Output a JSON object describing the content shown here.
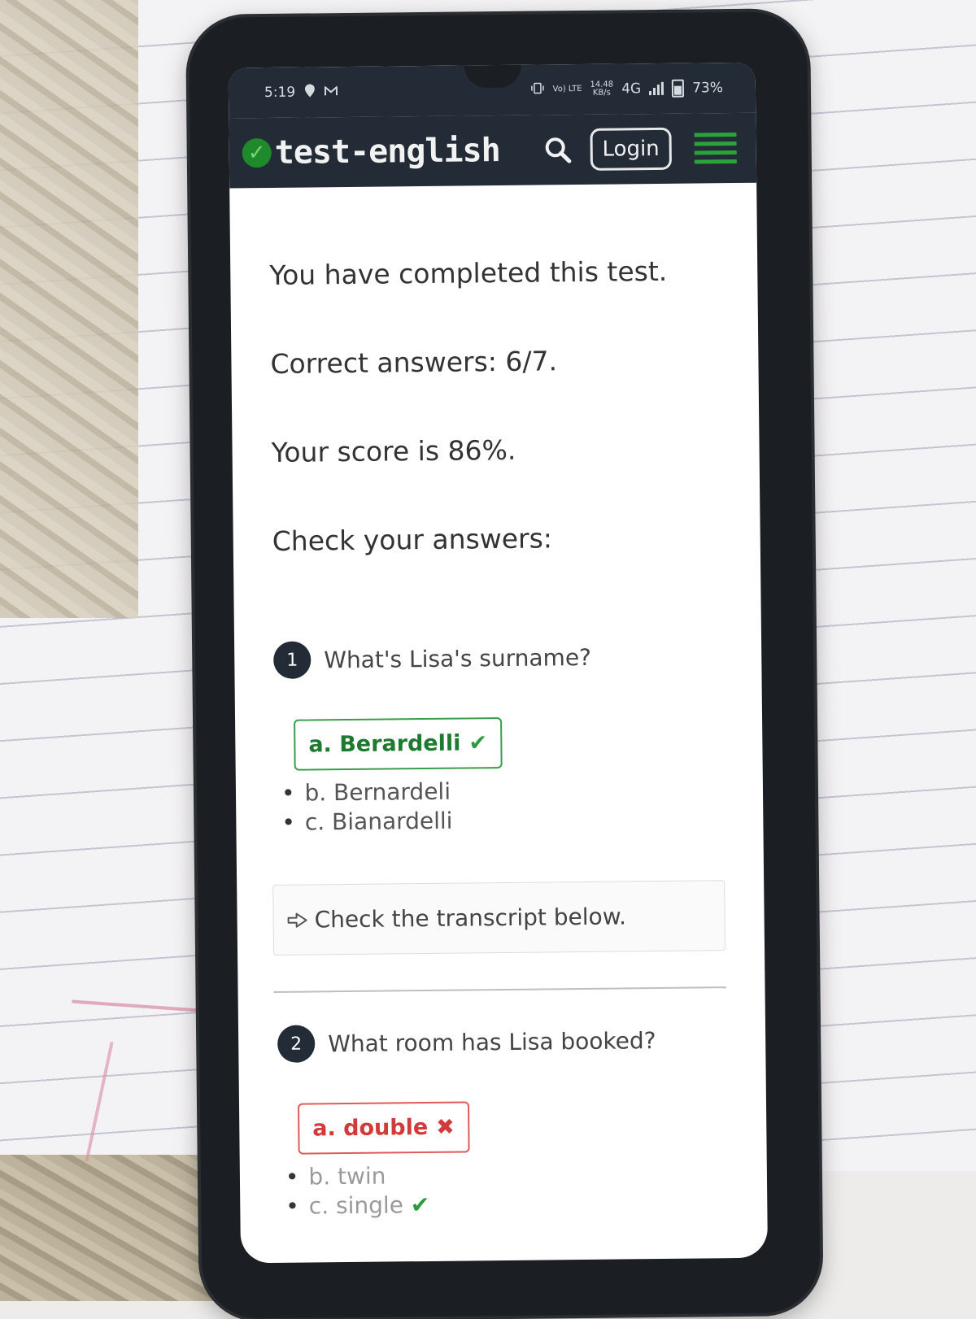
{
  "status_bar": {
    "time": "5:19",
    "network_speed_value": "14.48",
    "network_speed_unit": "KB/s",
    "volte": "Vo) LTE",
    "network_type": "4G",
    "battery": "73%"
  },
  "header": {
    "logo_text": "test-english",
    "login_label": "Login"
  },
  "results": {
    "completed": "You have completed this test.",
    "correct_answers": "Correct answers: 6/7.",
    "score": "Your score is 86%.",
    "check_heading": "Check your answers:"
  },
  "questions": [
    {
      "number": "1",
      "text": "What's Lisa's surname?",
      "selected": "a. Berardelli",
      "options": [
        "b. Bernardeli",
        "c. Bianardelli"
      ],
      "transcript_link": "Check the transcript below."
    },
    {
      "number": "2",
      "text": "What room has Lisa booked?",
      "selected": "a. double",
      "options": [
        "b. twin",
        "c. single"
      ]
    }
  ],
  "colors": {
    "header_bg": "#232c36",
    "brand_green": "#2aa33a",
    "correct": "#1d7a2e",
    "wrong": "#d23a3a"
  },
  "icons": [
    "search-icon",
    "menu-icon",
    "check-icon",
    "cross-icon",
    "arrow-right-icon"
  ]
}
